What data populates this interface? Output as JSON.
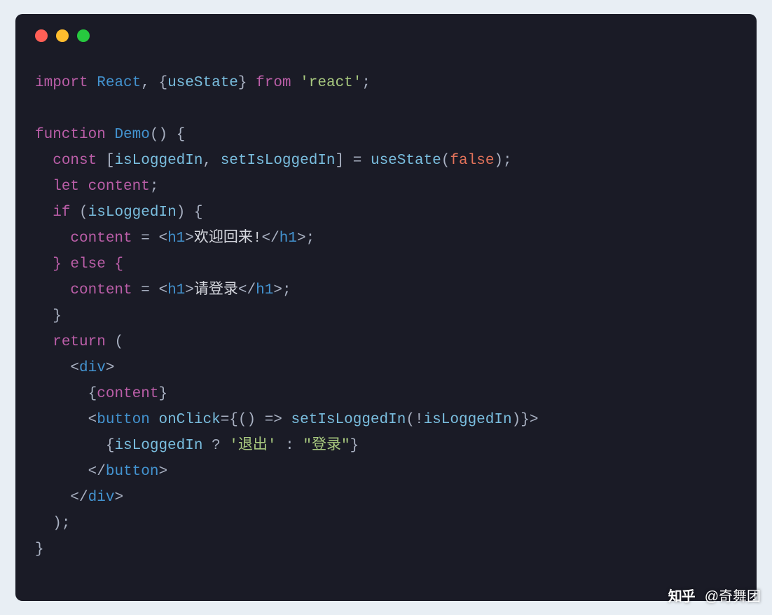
{
  "code": {
    "line1": {
      "import": "import",
      "react": "React",
      "comma": ",",
      "lb": "{",
      "usestate": "useState",
      "rb": "}",
      "from": "from",
      "str": "'react'",
      "semi": ";"
    },
    "line3": {
      "function": "function",
      "name": "Demo",
      "paren": "() {"
    },
    "line4": {
      "const": "const",
      "lb": "[",
      "v1": "isLoggedIn",
      "comma": ",",
      "v2": "setIsLoggedIn",
      "rb": "]",
      "eq": "=",
      "call": "useState",
      "lp": "(",
      "false": "false",
      "rp": ");"
    },
    "line5": {
      "let": "let",
      "var": "content",
      "semi": ";"
    },
    "line6": {
      "if": "if",
      "lp": "(",
      "cond": "isLoggedIn",
      "rp": ") {"
    },
    "line7": {
      "var": "content",
      "eq": "=",
      "lt1": "<",
      "tag1": "h1",
      "gt1": ">",
      "text": "欢迎回来!",
      "lt2": "</",
      "tag2": "h1",
      "gt2": ">",
      "semi": ";"
    },
    "line8": {
      "kw": "} else {"
    },
    "line9": {
      "var": "content",
      "eq": "=",
      "lt1": "<",
      "tag1": "h1",
      "gt1": ">",
      "text": "请登录",
      "lt2": "</",
      "tag2": "h1",
      "gt2": ">",
      "semi": ";"
    },
    "line10": {
      "rb": "}"
    },
    "line11": {
      "return": "return",
      "lp": "("
    },
    "line12": {
      "lt": "<",
      "tag": "div",
      "gt": ">"
    },
    "line13": {
      "lb": "{",
      "var": "content",
      "rb": "}"
    },
    "line14": {
      "lt": "<",
      "tag": "button",
      "attr": "onClick",
      "eq": "={() =>",
      "call": "setIsLoggedIn",
      "lp": "(!",
      "arg": "isLoggedIn",
      "rp": ")}",
      "gt": ">"
    },
    "line15": {
      "lb": "{",
      "cond": "isLoggedIn",
      "q": "?",
      "s1": "'退出'",
      "colon": ":",
      "s2": "\"登录\"",
      "rb": "}"
    },
    "line16": {
      "lt": "</",
      "tag": "button",
      "gt": ">"
    },
    "line17": {
      "lt": "</",
      "tag": "div",
      "gt": ">"
    },
    "line18": {
      "rp": ");"
    },
    "line19": {
      "rb": "}"
    }
  },
  "watermark": {
    "logo": "知乎",
    "author": "@奇舞团"
  }
}
